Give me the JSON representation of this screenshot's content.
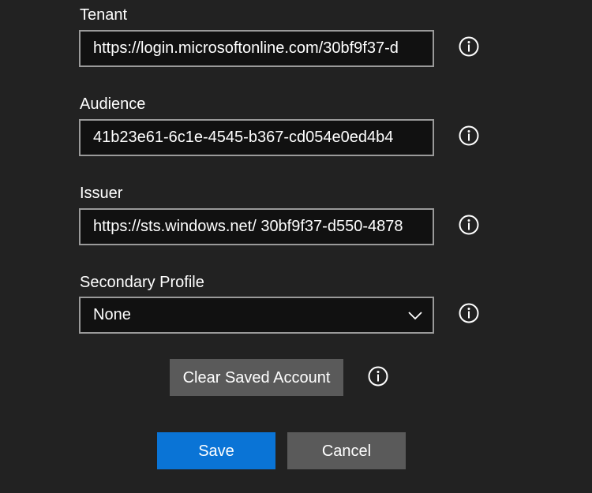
{
  "form": {
    "tenant": {
      "label": "Tenant",
      "value": "https://login.microsoftonline.com/30bf9f37-d"
    },
    "audience": {
      "label": "Audience",
      "value": "41b23e61-6c1e-4545-b367-cd054e0ed4b4"
    },
    "issuer": {
      "label": "Issuer",
      "value": "https://sts.windows.net/ 30bf9f37-d550-4878"
    },
    "secondary_profile": {
      "label": "Secondary Profile",
      "selected": "None"
    }
  },
  "buttons": {
    "clear_saved_account": "Clear Saved Account",
    "save": "Save",
    "cancel": "Cancel"
  },
  "icons": {
    "info": "info-icon",
    "dropdown": "chevron-down-icon"
  },
  "colors": {
    "background": "#222222",
    "field_background": "#111111",
    "field_border": "#9a9a9a",
    "primary_button": "#0a74d6",
    "secondary_button": "#5a5a5a"
  }
}
